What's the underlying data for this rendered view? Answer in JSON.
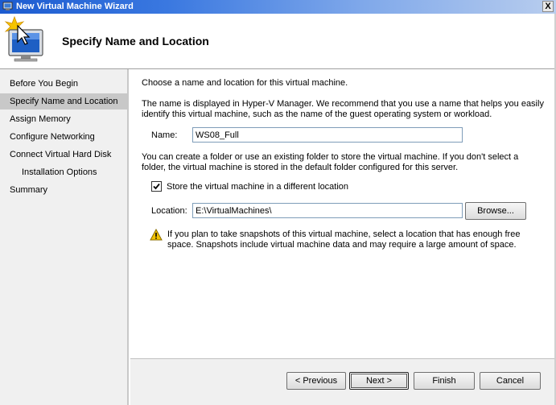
{
  "window": {
    "title": "New Virtual Machine Wizard",
    "close_glyph": "X"
  },
  "header": {
    "page_title": "Specify Name and Location",
    "icon": "wizard-monitor-icon"
  },
  "sidebar": {
    "items": [
      {
        "label": "Before You Begin",
        "active": false,
        "sub": false
      },
      {
        "label": "Specify Name and Location",
        "active": true,
        "sub": false
      },
      {
        "label": "Assign Memory",
        "active": false,
        "sub": false
      },
      {
        "label": "Configure Networking",
        "active": false,
        "sub": false
      },
      {
        "label": "Connect Virtual Hard Disk",
        "active": false,
        "sub": false
      },
      {
        "label": "Installation Options",
        "active": false,
        "sub": true
      },
      {
        "label": "Summary",
        "active": false,
        "sub": false
      }
    ]
  },
  "main": {
    "intro": "Choose a name and location for this virtual machine.",
    "name_help": "The name is displayed in Hyper-V Manager. We recommend that you use a name that helps you easily identify this virtual machine, such as the name of the guest operating system or workload.",
    "name_label": "Name:",
    "name_value": "WS08_Full",
    "folder_help": "You can create a folder or use an existing folder to store the virtual machine. If you don't select a folder, the virtual machine is stored in the default folder configured for this server.",
    "store_checkbox_label": "Store the virtual machine in a different location",
    "store_checkbox_checked": true,
    "location_label": "Location:",
    "location_value": "E:\\VirtualMachines\\",
    "browse_label": "Browse...",
    "warning_text": "If you plan to take snapshots of this virtual machine, select a location that has enough free space. Snapshots include virtual machine data and may require a large amount of space.",
    "warning_icon": "warning-triangle-icon"
  },
  "footer": {
    "previous_label": "< Previous",
    "next_label": "Next >",
    "finish_label": "Finish",
    "cancel_label": "Cancel"
  },
  "colors": {
    "title_bar": "#1c5bd0",
    "sidebar_bg": "#f0f0f0",
    "sidebar_active": "#c8c8c8",
    "warning": "#f2c200"
  }
}
